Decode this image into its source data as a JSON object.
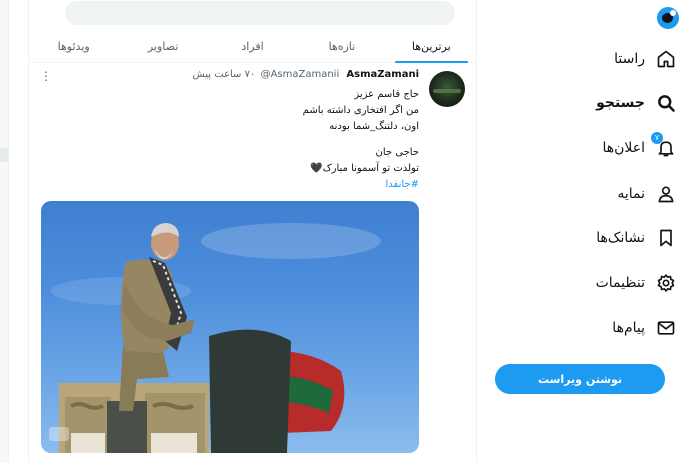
{
  "feed": {
    "search_placeholder": "",
    "tabs": [
      {
        "label": "برترین‌ها",
        "active": true
      },
      {
        "label": "تازه‌ها",
        "active": false
      },
      {
        "label": "افراد",
        "active": false
      },
      {
        "label": "تصاویر",
        "active": false
      },
      {
        "label": "ویدئوها",
        "active": false
      }
    ],
    "tweet": {
      "display_name": "AsmaZamani",
      "handle": "@AsmaZamanii",
      "time": "۷۰ ساعت پیش",
      "lines": [
        "حاج قاسم عزیز",
        "من اگر افتخاری داشته باشم",
        "اون، دلتنگ_شما بودنه",
        "",
        "حاجی جان",
        "تولدت تو آسمونا مبارک🖤",
        "#جانفدا"
      ]
    }
  },
  "sidebar": {
    "items": [
      {
        "label": "راستا",
        "icon": "home-icon"
      },
      {
        "label": "جستجو",
        "icon": "search-icon",
        "active": true
      },
      {
        "label": "اعلان‌ها",
        "icon": "bell-icon",
        "badge": "۷"
      },
      {
        "label": "نمایه",
        "icon": "profile-icon"
      },
      {
        "label": "نشانک‌ها",
        "icon": "bookmark-icon"
      },
      {
        "label": "تنظیمات",
        "icon": "settings-icon"
      },
      {
        "label": "پیام‌ها",
        "icon": "mail-icon"
      }
    ],
    "post_button": "نوشتن ویراست"
  },
  "colors": {
    "accent": "#1d9bf0",
    "text": "#0f1419",
    "muted": "#536471",
    "divider": "#eff3f4"
  }
}
